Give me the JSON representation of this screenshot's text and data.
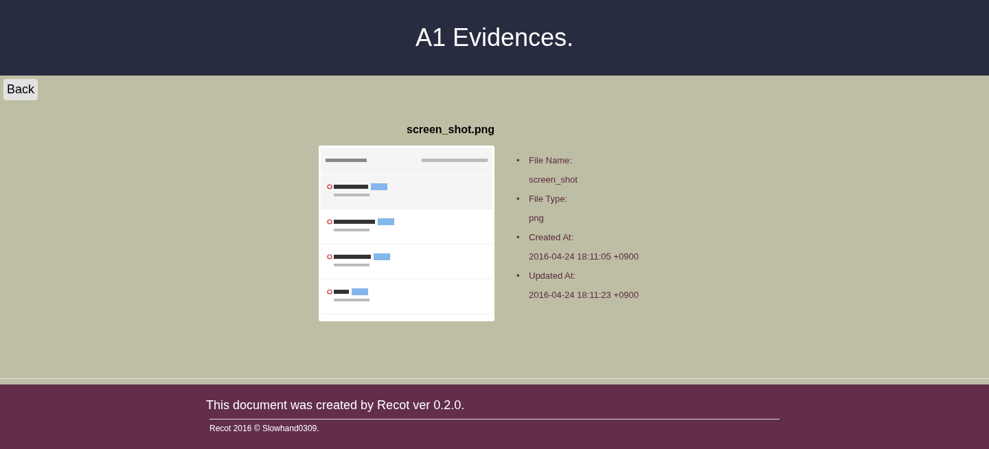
{
  "header": {
    "title": "A1 Evidences."
  },
  "back_button": {
    "label": "Back"
  },
  "evidence": {
    "file_title": "screen_shot.png",
    "details": [
      {
        "marker": "•",
        "label": "File Name:",
        "value": "screen_shot"
      },
      {
        "marker": "•",
        "label": "File Type:",
        "value": "png"
      },
      {
        "marker": "•",
        "label": "Created At:",
        "value": "2016-04-24 18:11:05 +0900"
      },
      {
        "marker": "•",
        "label": "Updated At:",
        "value": "2016-04-24 18:11:23 +0900"
      }
    ]
  },
  "footer": {
    "note": "This document was created by Recot ver 0.2.0.",
    "copyright": "Recot 2016 © Slowhand0309."
  }
}
